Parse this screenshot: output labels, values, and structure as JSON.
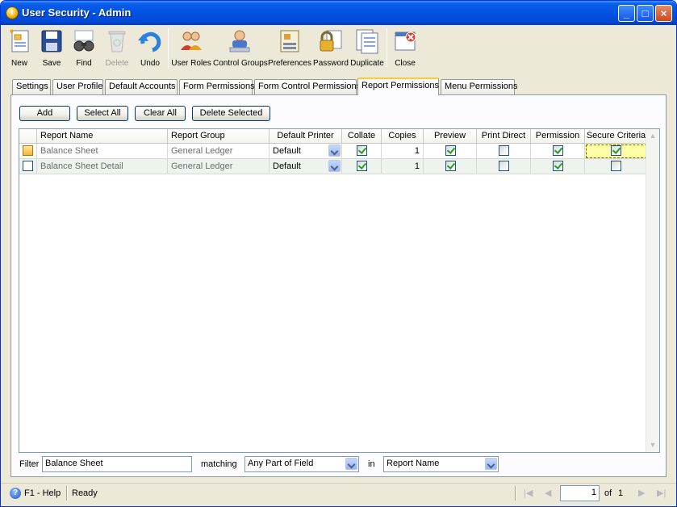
{
  "window": {
    "title": "User Security - Admin",
    "controls": [
      "_",
      "□",
      "×"
    ]
  },
  "toolbar": {
    "items": [
      {
        "label": "New",
        "icon": "new-document-icon",
        "enabled": true
      },
      {
        "label": "Save",
        "icon": "floppy-disk-icon",
        "enabled": true
      },
      {
        "label": "Find",
        "icon": "binoculars-icon",
        "enabled": true
      },
      {
        "label": "Delete",
        "icon": "recycle-bin-icon",
        "enabled": false
      },
      {
        "label": "Undo",
        "icon": "undo-arrow-icon",
        "enabled": true
      },
      {
        "label": "User Roles",
        "icon": "user-roles-icon",
        "enabled": true
      },
      {
        "label": "Control Groups",
        "icon": "control-groups-icon",
        "enabled": true
      },
      {
        "label": "Preferences",
        "icon": "preferences-icon",
        "enabled": true
      },
      {
        "label": "Password",
        "icon": "password-lock-icon",
        "enabled": true
      },
      {
        "label": "Duplicate",
        "icon": "duplicate-icon",
        "enabled": true
      },
      {
        "label": "Close",
        "icon": "close-window-icon",
        "enabled": true
      }
    ]
  },
  "tabs": [
    {
      "label": "Settings"
    },
    {
      "label": "User Profile"
    },
    {
      "label": "Default Accounts"
    },
    {
      "label": "Form Permissions"
    },
    {
      "label": "Form Control Permissions"
    },
    {
      "label": "Report Permissions",
      "active": true
    },
    {
      "label": "Menu Permissions"
    }
  ],
  "actions": {
    "add": "Add",
    "select_all": "Select All",
    "clear_all": "Clear All",
    "delete_selected": "Delete Selected"
  },
  "grid": {
    "columns": [
      "Report Name",
      "Report Group",
      "Default Printer",
      "Collate",
      "Copies",
      "Preview",
      "Print Direct",
      "Permission",
      "Secure Criteria"
    ],
    "rows": [
      {
        "report_name": "Balance Sheet",
        "report_group": "General Ledger",
        "default_printer": "Default",
        "collate": true,
        "copies": "1",
        "preview": true,
        "print_direct": false,
        "permission": true,
        "secure_criteria": true,
        "current": true
      },
      {
        "report_name": "Balance Sheet Detail",
        "report_group": "General Ledger",
        "default_printer": "Default",
        "collate": true,
        "copies": "1",
        "preview": true,
        "print_direct": false,
        "permission": true,
        "secure_criteria": false,
        "current": false
      }
    ]
  },
  "filter": {
    "label": "Filter",
    "value": "Balance Sheet",
    "matching_label": "matching",
    "matching_value": "Any Part of Field",
    "in_label": "in",
    "in_value": "Report Name"
  },
  "status": {
    "help": "F1 - Help",
    "state": "Ready",
    "page": "1",
    "of_label": "of",
    "total_pages": "1"
  },
  "colors": {
    "titlebar": "#0054e3",
    "tab_accent": "#ffc83c",
    "check": "#21a121",
    "highlight": "#ffffa8"
  }
}
